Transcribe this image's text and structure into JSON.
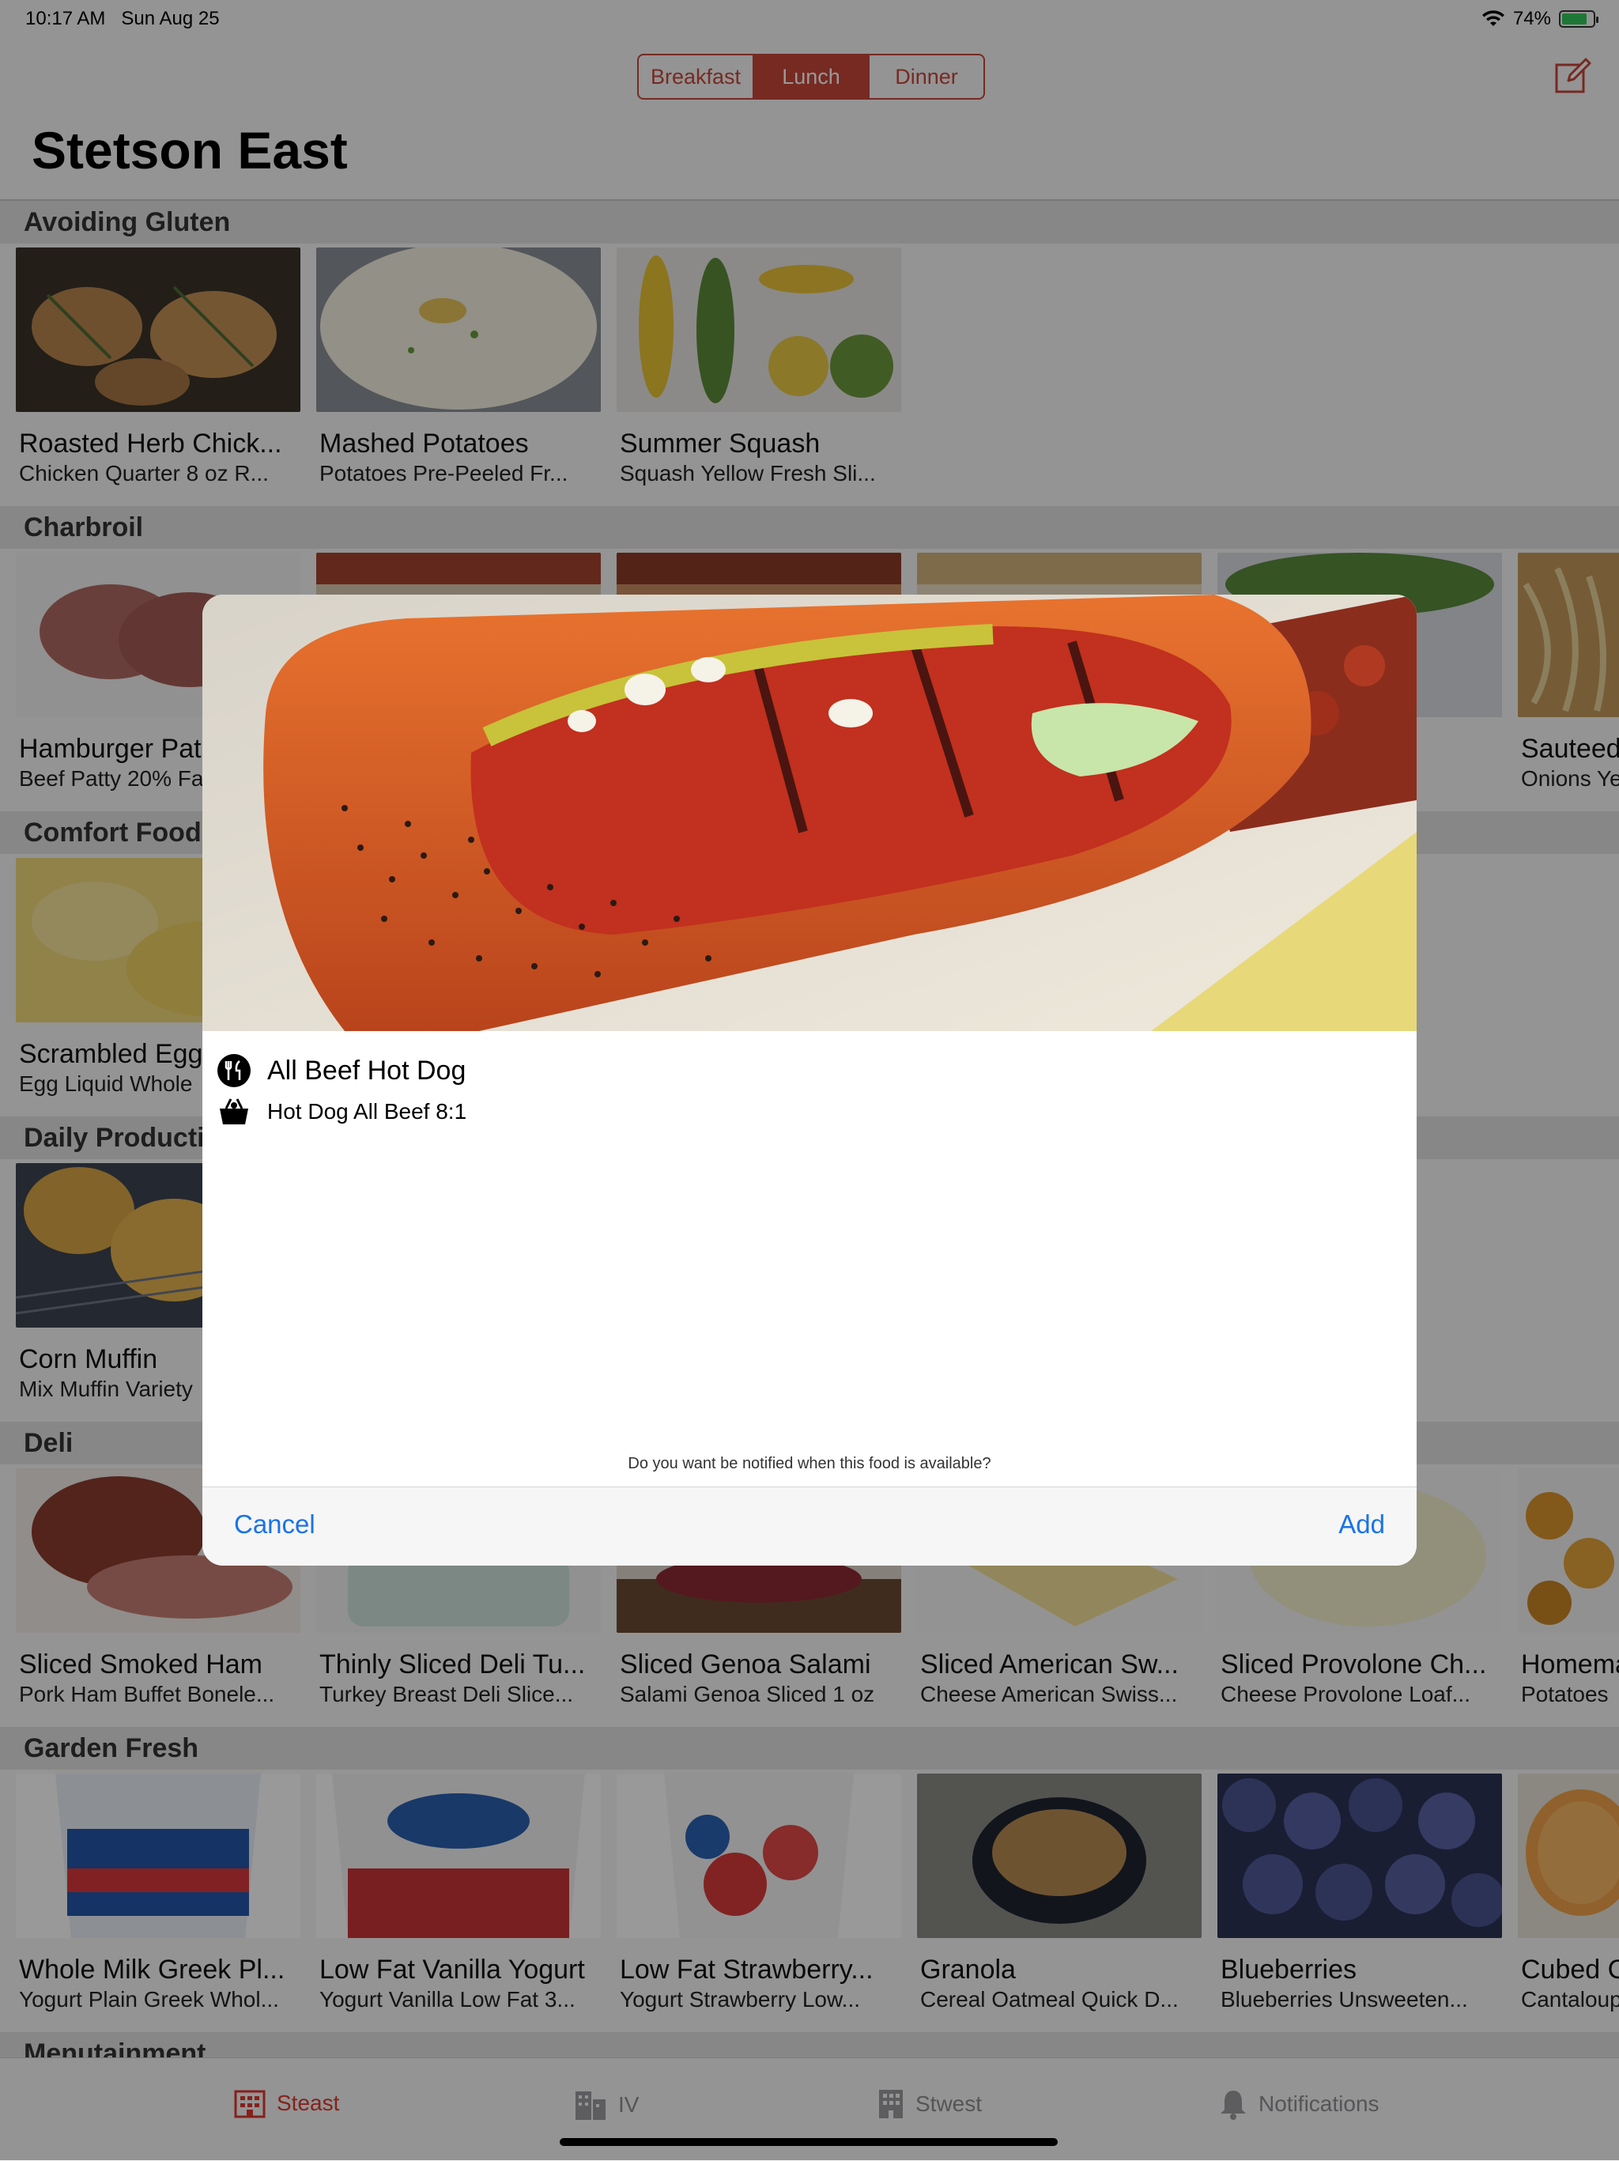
{
  "status": {
    "time": "10:17 AM",
    "date": "Sun Aug 25",
    "battery": "74%",
    "battery_level": 0.74
  },
  "meal_tabs": {
    "items": [
      "Breakfast",
      "Lunch",
      "Dinner"
    ],
    "selected": "Lunch"
  },
  "page_title": "Stetson East",
  "colors": {
    "accent": "#c5473a",
    "tab_active": "#e0372e",
    "link": "#1a73e8"
  },
  "sections": {
    "gluten": {
      "title": "Avoiding Gluten",
      "items": [
        {
          "title": "Roasted Herb Chick...",
          "sub": "Chicken Quarter 8 oz R..."
        },
        {
          "title": "Mashed Potatoes",
          "sub": "Potatoes Pre-Peeled Fr..."
        },
        {
          "title": "Summer Squash",
          "sub": "Squash Yellow Fresh Sli..."
        }
      ]
    },
    "charbroil": {
      "title": "Charbroil",
      "items": [
        {
          "title": "Hamburger Pat",
          "sub": "Beef Patty 20% Fa"
        },
        {
          "title": "",
          "sub": ""
        },
        {
          "title": "",
          "sub": ""
        },
        {
          "title": "",
          "sub": ""
        },
        {
          "title": "",
          "sub": "ue 4..."
        },
        {
          "title": "Sauteed",
          "sub": "Onions Ye"
        }
      ]
    },
    "comfort": {
      "title": "Comfort Foods",
      "items": [
        {
          "title": "Scrambled Egg",
          "sub": "Egg Liquid Whole"
        }
      ]
    },
    "daily": {
      "title": "Daily Producti",
      "items": [
        {
          "title": "Corn Muffin",
          "sub": "Mix Muffin Variety"
        }
      ]
    },
    "deli": {
      "title": "Deli",
      "items": [
        {
          "title": "Sliced Smoked Ham",
          "sub": "Pork Ham Buffet Bonele..."
        },
        {
          "title": "Thinly Sliced Deli Tu...",
          "sub": "Turkey Breast Deli Slice..."
        },
        {
          "title": "Sliced Genoa Salami",
          "sub": "Salami Genoa Sliced 1 oz"
        },
        {
          "title": "Sliced American Sw...",
          "sub": "Cheese American Swiss..."
        },
        {
          "title": "Sliced Provolone Ch...",
          "sub": "Cheese Provolone Loaf..."
        },
        {
          "title": "Homema",
          "sub": "Potatoes"
        }
      ]
    },
    "garden": {
      "title": "Garden Fresh",
      "items": [
        {
          "title": "Whole Milk Greek Pl...",
          "sub": "Yogurt Plain Greek Whol..."
        },
        {
          "title": "Low Fat Vanilla Yogurt",
          "sub": "Yogurt Vanilla Low Fat 3..."
        },
        {
          "title": "Low Fat Strawberry...",
          "sub": "Yogurt Strawberry Low..."
        },
        {
          "title": "Granola",
          "sub": "Cereal Oatmeal Quick D..."
        },
        {
          "title": "Blueberries",
          "sub": "Blueberries Unsweeten..."
        },
        {
          "title": "Cubed C",
          "sub": "Cantaloup"
        }
      ]
    },
    "menutainment": {
      "title": "Menutainment"
    }
  },
  "modal": {
    "food_name": "All Beef Hot Dog",
    "food_sub": "Hot Dog All Beef 8:1",
    "question": "Do you want be notified when this food is available?",
    "cancel": "Cancel",
    "add": "Add"
  },
  "tabbar": {
    "items": [
      "Steast",
      "IV",
      "Stwest",
      "Notifications"
    ],
    "selected": "Steast"
  }
}
